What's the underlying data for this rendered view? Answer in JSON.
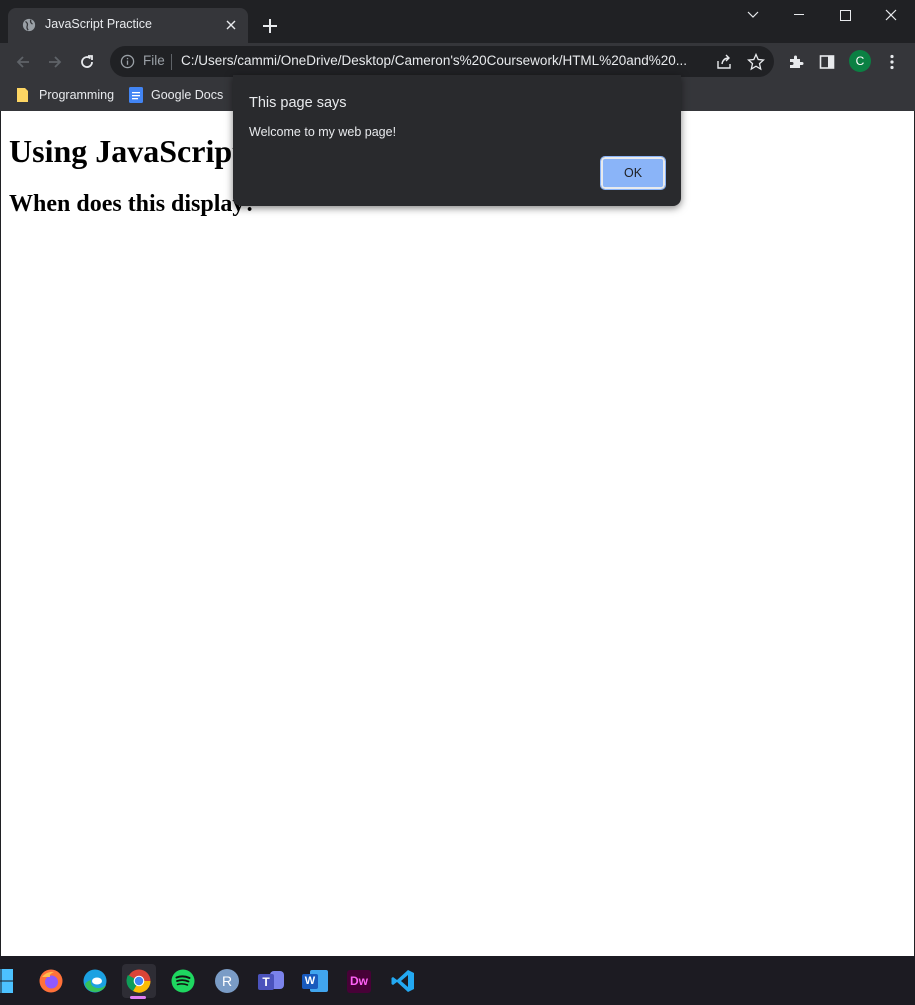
{
  "browser": {
    "tab": {
      "title": "JavaScript Practice"
    },
    "address": {
      "scheme_label": "File",
      "url": "C:/Users/cammi/OneDrive/Desktop/Cameron's%20Coursework/HTML%20and%20..."
    },
    "profile_initial": "C",
    "bookmarks": [
      {
        "label": "Programming",
        "icon": "folder-icon"
      },
      {
        "label": "Google Docs",
        "icon": "google-docs-icon"
      }
    ]
  },
  "page": {
    "heading": "Using JavaScript",
    "subheading": "When does this display?"
  },
  "alert": {
    "title": "This page says",
    "message": "Welcome to my web page!",
    "ok_label": "OK"
  },
  "taskbar": {
    "apps": [
      "start",
      "firefox",
      "edge",
      "chrome",
      "spotify",
      "r",
      "teams",
      "word",
      "dreamweaver",
      "vscode"
    ],
    "active": "chrome",
    "r_label": "R",
    "teams_label": "T",
    "word_label": "W",
    "dreamweaver_label": "Dw"
  },
  "colors": {
    "accent": "#8ab4f8",
    "chrome_dark": "#202124",
    "toolbar": "#35363a",
    "avatar": "#0b8043"
  }
}
